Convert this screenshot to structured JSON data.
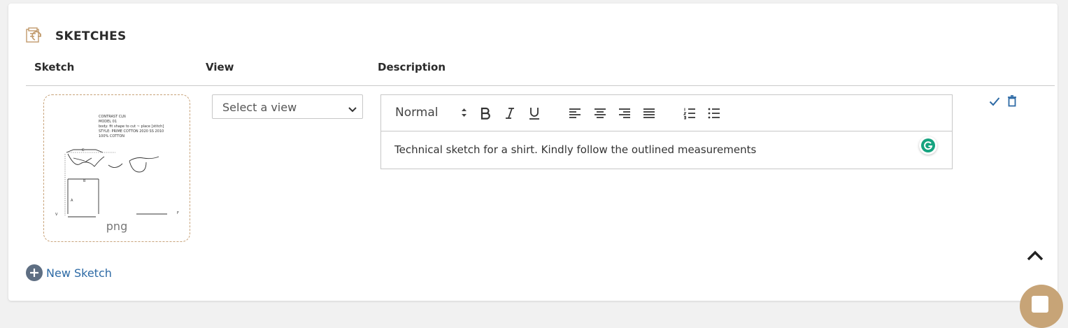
{
  "section": {
    "title": "SKETCHES",
    "icon": "sketch-section-icon"
  },
  "columns": {
    "sketch": "Sketch",
    "view": "View",
    "description": "Description"
  },
  "rows": [
    {
      "sketch": {
        "file_type": "png",
        "thumbnail_text": [
          "CONTRAST CLN",
          "MODEL 01",
          "body: fit shape to cut ~ place [stitch]",
          "STYLE: PRIME COTTON 2020 SS 2010",
          "100% COTTON"
        ],
        "measure_labels": [
          "C",
          "B",
          "A",
          "V",
          "F"
        ]
      },
      "view_select": {
        "selected": "Select a view"
      },
      "description": {
        "format": "Normal",
        "text": "Technical sketch for a shirt. Kindly follow the outlined measurements",
        "toolbar": [
          "bold",
          "italic",
          "underline",
          "align-left",
          "align-center",
          "align-right",
          "align-justify",
          "ordered-list",
          "bullet-list"
        ]
      }
    }
  ],
  "actions": {
    "add_label": "New Sketch"
  },
  "colors": {
    "accent_gold": "#c7a477",
    "link_blue": "#2d6aa5",
    "action_blue": "#2d6aa5",
    "grammarly_green": "#15a37f"
  }
}
